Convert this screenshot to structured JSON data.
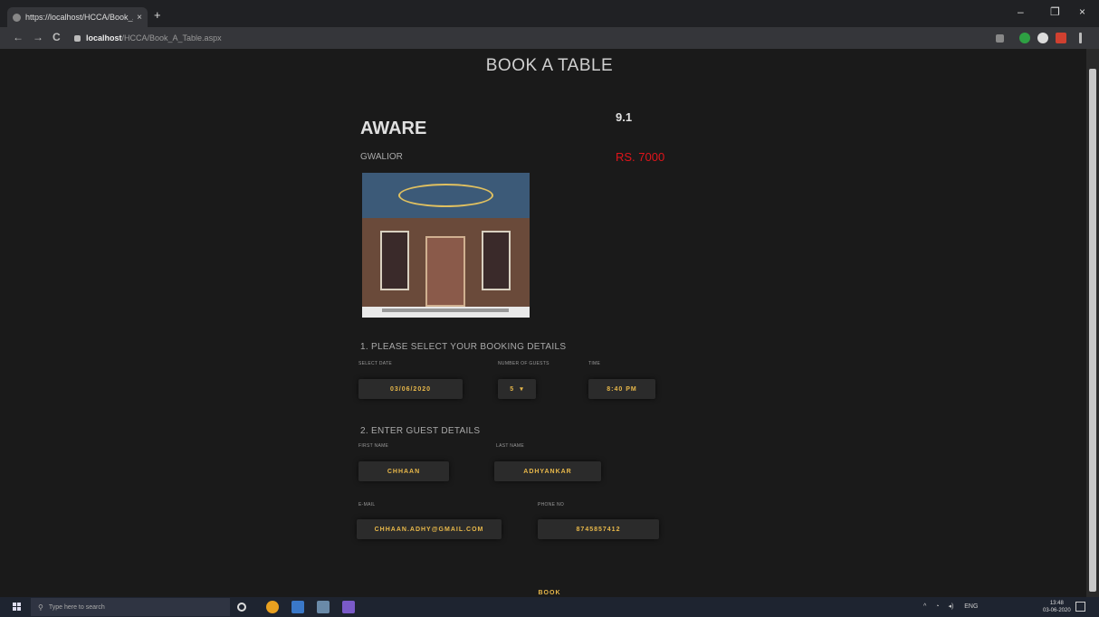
{
  "browser": {
    "tab_title": "https://localhost/HCCA/Book_A...",
    "tab_close": "×",
    "new_tab": "+",
    "back": "←",
    "forward": "→",
    "reload": "C",
    "url_host": "localhost",
    "url_path": "/HCCA/Book_A_Table.aspx",
    "window_minimize": "–",
    "window_maximize": "❐",
    "window_close": "×"
  },
  "page": {
    "heading": "BOOK A TABLE",
    "restaurant_name": "AWARE",
    "rating": "9.1",
    "city": "GWALIOR",
    "price": "RS. 7000"
  },
  "booking": {
    "section_title": "1. PLEASE SELECT YOUR BOOKING DETAILS",
    "date_label": "SELECT DATE",
    "date_value": "03/06/2020",
    "guests_label": "NUMBER OF GUESTS",
    "guests_value": "5",
    "guests_arrow": "▾",
    "time_label": "TIME",
    "time_value": "8:40 PM"
  },
  "guest": {
    "section_title": "2. ENTER GUEST DETAILS",
    "first_label": "FIRST NAME",
    "first_value": "CHHAAN",
    "last_label": "LAST NAME",
    "last_value": "ADHYANKAR",
    "email_label": "E-MAIL",
    "email_value": "CHHAAN.ADHY@GMAIL.COM",
    "phone_label": "PHONE NO",
    "phone_value": "8745857412"
  },
  "actions": {
    "book": "BOOK"
  },
  "taskbar": {
    "search_placeholder": "Type here to search",
    "tray_lang": "ENG",
    "clock_time": "13:48",
    "clock_date": "03-06-2020"
  },
  "colors": {
    "page_bg": "#1a1a1a",
    "accent_gold": "#e8b84a",
    "price_red": "#e0141a"
  }
}
